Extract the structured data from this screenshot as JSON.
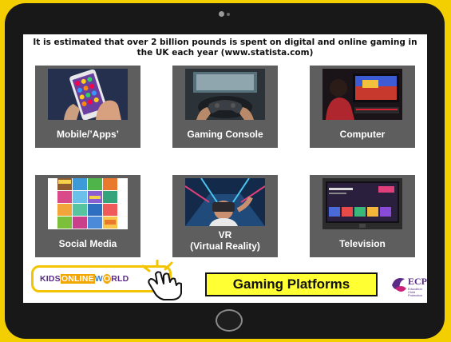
{
  "slide": {
    "header_text": "It is estimated that over 2 billion pounds is spent on digital and online gaming in the UK each year (www.statista.com)",
    "tiles": [
      {
        "label": "Mobile/’Apps’",
        "icon": "mobile-phone-image"
      },
      {
        "label": "Gaming Console",
        "icon": "gaming-console-image"
      },
      {
        "label": "Computer",
        "icon": "computer-image"
      },
      {
        "label": "Social Media",
        "icon": "social-media-games-image"
      },
      {
        "label": "VR\n(Virtual Reality)",
        "icon": "vr-headset-image"
      },
      {
        "label": "Television",
        "icon": "television-image"
      }
    ],
    "logo": {
      "part_kids": "KIDS",
      "part_online": "ONLINE",
      "part_w": "W",
      "part_o": "O",
      "part_rld": "RLD"
    },
    "caption": "Gaming Platforms",
    "ecp": {
      "name": "ECP",
      "sub": "Education Child Protection"
    }
  },
  "colors": {
    "background": "#f3ce00",
    "tile": "#5e5e5e",
    "caption_bg": "#ffff33",
    "brand_purple": "#5a2a86"
  }
}
